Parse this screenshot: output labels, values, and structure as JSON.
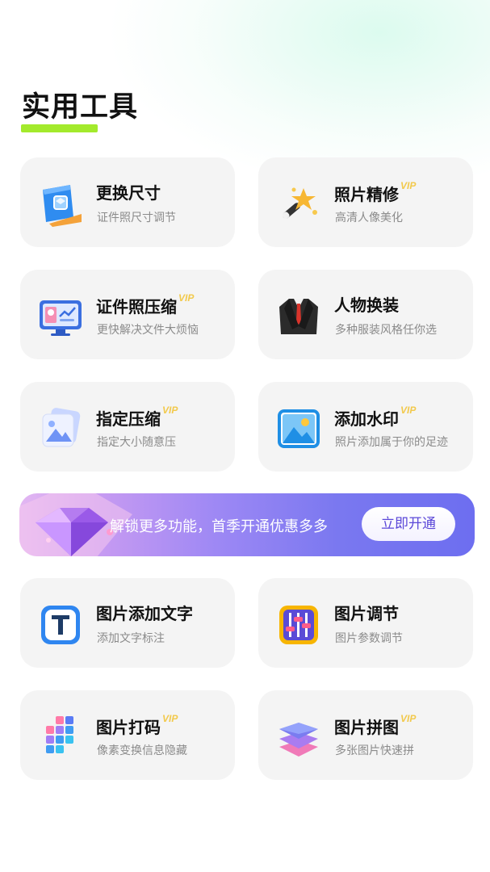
{
  "section": {
    "title": "实用工具"
  },
  "vip_label": "VIP",
  "colors": {
    "accent": "#a3ea2c",
    "vip": "#f2c94c",
    "banner_btn_text": "#5b48d8"
  },
  "tools_top": [
    {
      "name": "更换尺寸",
      "desc": "证件照尺寸调节",
      "vip": false,
      "icon": "resize-ruler-icon"
    },
    {
      "name": "照片精修",
      "desc": "高清人像美化",
      "vip": true,
      "icon": "magic-wand-icon"
    },
    {
      "name": "证件照压缩",
      "desc": "更快解决文件大烦恼",
      "vip": true,
      "icon": "monitor-profile-icon"
    },
    {
      "name": "人物换装",
      "desc": "多种服装风格任你选",
      "vip": false,
      "icon": "suit-icon"
    },
    {
      "name": "指定压缩",
      "desc": "指定大小随意压",
      "vip": true,
      "icon": "photo-stack-icon"
    },
    {
      "name": "添加水印",
      "desc": "照片添加属于你的足迹",
      "vip": true,
      "icon": "picture-icon"
    }
  ],
  "banner": {
    "text": "解锁更多功能，首季开通优惠多多",
    "button": "立即开通"
  },
  "tools_bottom": [
    {
      "name": "图片添加文字",
      "desc": "添加文字标注",
      "vip": false,
      "icon": "text-t-icon"
    },
    {
      "name": "图片调节",
      "desc": "图片参数调节",
      "vip": false,
      "icon": "sliders-icon"
    },
    {
      "name": "图片打码",
      "desc": "像素变换信息隐藏",
      "vip": true,
      "icon": "pixel-blocks-icon"
    },
    {
      "name": "图片拼图",
      "desc": "多张图片快速拼",
      "vip": true,
      "icon": "layers-icon"
    }
  ]
}
